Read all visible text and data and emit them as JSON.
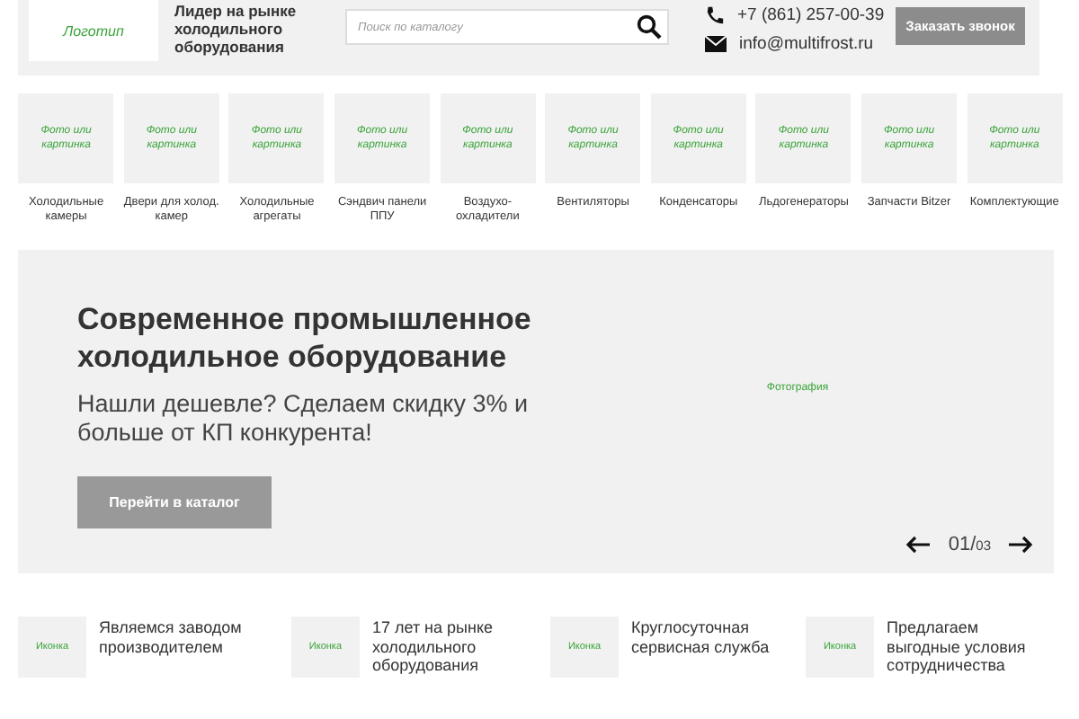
{
  "header": {
    "logo": "Логотип",
    "tagline": "Лидер на рынке холодильного оборудования",
    "search": {
      "placeholder": "Поиск по каталогу"
    },
    "phone": "+7 (861) 257-00-39",
    "email": "info@multifrost.ru",
    "callback_button": "Заказать звонок"
  },
  "categories": [
    {
      "image": "Фото или картинка",
      "label": "Холодильные камеры"
    },
    {
      "image": "Фото или картинка",
      "label": "Двери для холод. камер"
    },
    {
      "image": "Фото или картинка",
      "label": "Холодильные агрегаты"
    },
    {
      "image": "Фото или картинка",
      "label": "Сэндвич панели ППУ"
    },
    {
      "image": "Фото или картинка",
      "label": "Воздухо-охладители"
    },
    {
      "image": "Фото или картинка",
      "label": "Вентиляторы"
    },
    {
      "image": "Фото или картинка",
      "label": "Конденсаторы"
    },
    {
      "image": "Фото или картинка",
      "label": "Льдогенераторы"
    },
    {
      "image": "Фото или картинка",
      "label": "Запчасти Bitzer"
    },
    {
      "image": "Фото или картинка",
      "label": "Комплектующие"
    }
  ],
  "hero": {
    "title": "Современное промышленное холодильное оборудование",
    "subtitle": "Нашли дешевле? Сделаем скидку 3% и больше от КП конкурента!",
    "button": "Перейти в каталог",
    "photo": "Фотография",
    "current": "01/",
    "total": "03"
  },
  "features": [
    {
      "icon": "Иконка",
      "text": "Являемся заводом производителем"
    },
    {
      "icon": "Иконка",
      "text": "17 лет на рынке холодильного оборудования"
    },
    {
      "icon": "Иконка",
      "text": "Круглосуточная сервисная служба"
    },
    {
      "icon": "Иконка",
      "text": "Предлагаем выгодные условия сотрудничества"
    }
  ]
}
